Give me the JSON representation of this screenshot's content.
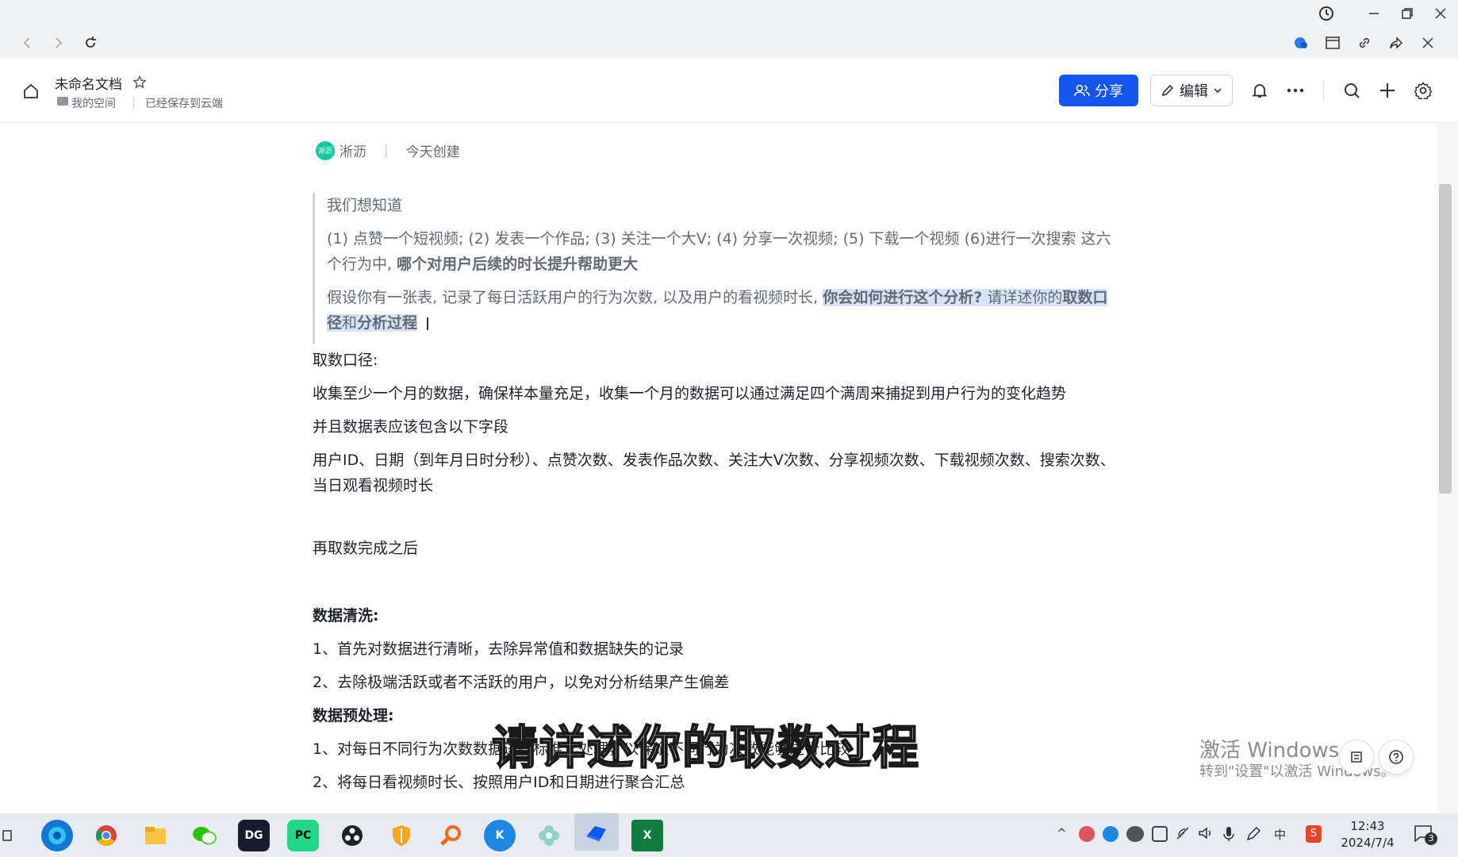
{
  "window": {
    "history_icon": "history-icon",
    "minimize": "minimize-icon",
    "restore": "restore-icon",
    "close": "close-icon"
  },
  "toolbar": {
    "back": "back-icon",
    "forward": "forward-icon",
    "reload": "reload-icon"
  },
  "header": {
    "title": "未命名文档",
    "breadcrumb": "我的空间",
    "save_status": "已经保存到云端",
    "share_label": "分享",
    "edit_label": "编辑"
  },
  "doc": {
    "author": "淅沥",
    "author_avatar": "淅沥",
    "created": "今天创建",
    "quote": {
      "line1": "我们想知道",
      "line2": "(1) 点赞一个短视频; (2) 发表一个作品; (3) 关注一个大V; (4) 分享一次视频; (5) 下载一个视频 (6)进行一次搜索 这六个行为中, ",
      "line2_bold": "哪个对用户后续的时长提升帮助更大",
      "line3": "假设你有一张表, 记录了每日活跃用户的行为次数, 以及用户的看视频时长, ",
      "line3_bold": "你会如何进行这个分析?",
      "line3_tail": " 请详述你的",
      "line3_bold2": "取数口径",
      "line3_and": "和",
      "line3_bold3": "分析过程"
    },
    "p1": "取数口径:",
    "p2": "收集至少一个月的数据，确保样本量充足，收集一个月的数据可以通过满足四个满周来捕捉到用户行为的变化趋势",
    "p3": "并且数据表应该包含以下字段",
    "p4": "用户ID、日期（到年月日时分秒）、点赞次数、发表作品次数、关注大V次数、分享视频次数、下载视频次数、搜索次数、当日观看视频时长",
    "p5": "再取数完成之后",
    "p6": "数据清洗:",
    "p7": "1、首先对数据进行清晰，去除异常值和数据缺失的记录",
    "p8": "2、去除极端活跃或者不活跃的用户，以免对分析结果产生偏差",
    "p9": "数据预处理:",
    "p10": "1、对每日不同行为次数数据进行标准化处理，以保证不同行为次数能够进行比较",
    "p11": "2、将每日看视频时长、按照用户ID和日期进行聚合汇总"
  },
  "subtitle": "请详述你的取数过程",
  "watermark": {
    "line1": "激活 Windows",
    "line2": "转到\"设置\"以激活 Windows。"
  },
  "taskbar": {
    "time": "12:43",
    "date": "2024/7/4",
    "ime": "中",
    "notification_count": "3",
    "apps": [
      "edge",
      "chrome",
      "file-explorer",
      "wechat",
      "dg",
      "pycharm",
      "davinci",
      "shield",
      "search-tool",
      "k-app",
      "flower-app",
      "feishu",
      "excel"
    ]
  }
}
